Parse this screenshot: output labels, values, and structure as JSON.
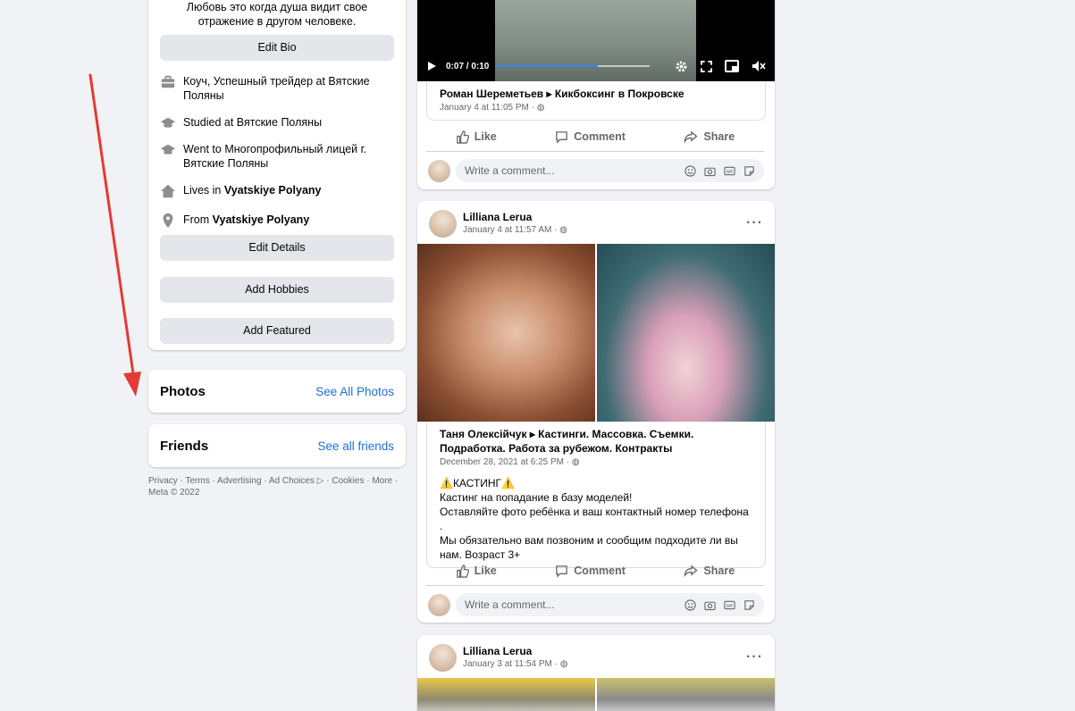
{
  "intro": {
    "bio": "Любовь это когда душа видит свое отражение в другом человеке.",
    "edit_bio": "Edit Bio",
    "details": [
      {
        "icon": "briefcase-icon",
        "text": "Коуч, Успешный трейдер at Вятские Поляны",
        "bold": ""
      },
      {
        "icon": "graduation-cap-icon",
        "text": "Studied at Вятские Поляны",
        "bold": ""
      },
      {
        "icon": "graduation-cap-icon",
        "text": "Went to Многопрофильный лицей г. Вятские Поляны",
        "bold": ""
      },
      {
        "icon": "home-icon",
        "text": "Lives in ",
        "bold": "Vyatskiye Polyany"
      },
      {
        "icon": "location-pin-icon",
        "text": "From ",
        "bold": "Vyatskiye Polyany"
      }
    ],
    "edit_details": "Edit Details",
    "add_hobbies": "Add Hobbies",
    "add_featured": "Add Featured"
  },
  "photos": {
    "title": "Photos",
    "link": "See All Photos"
  },
  "friends": {
    "title": "Friends",
    "link": "See all friends"
  },
  "footer": {
    "line1": "Privacy · Terms · Advertising · Ad Choices ▷ · Cookies · More ·",
    "line2": "Meta © 2022"
  },
  "posts": [
    {
      "video": {
        "time": "0:07 / 0:10",
        "progress": 0.66
      },
      "shared_title": "Роман Шереметьев ▸ Кикбоксинг в Покровске",
      "shared_meta": "January 4 at 11:05 PM · ◍",
      "like": "Like",
      "comment": "Comment",
      "share": "Share",
      "comment_placeholder": "Write a comment..."
    },
    {
      "author": "Lilliana Lerua",
      "meta": "January 4 at 11:57 AM · ◍",
      "shared_title": "Таня Олексійчук ▸ Кастинги. Массовка. Съемки. Подработка. Работа за рубежом. Контракты",
      "shared_meta": "December 28, 2021 at 6:25 PM · ◍",
      "shared_text": [
        "⚠️КАСТИНГ⚠️",
        "Кастинг на попадание в базу моделей!",
        "Оставляйте фото ребёнка и ваш контактный номер телефона .",
        "Мы обязательно вам позвоним и сообщим подходите ли вы",
        "нам. Возраст 3+"
      ],
      "like": "Like",
      "comment": "Comment",
      "share": "Share",
      "comment_placeholder": "Write a comment..."
    },
    {
      "author": "Lilliana Lerua",
      "meta": "January 3 at 11:54 PM · ◍"
    }
  ],
  "colors": {
    "accent": "#216fdb",
    "annotation_arrow": "#e53935",
    "video_progress": "#2d88ff"
  }
}
